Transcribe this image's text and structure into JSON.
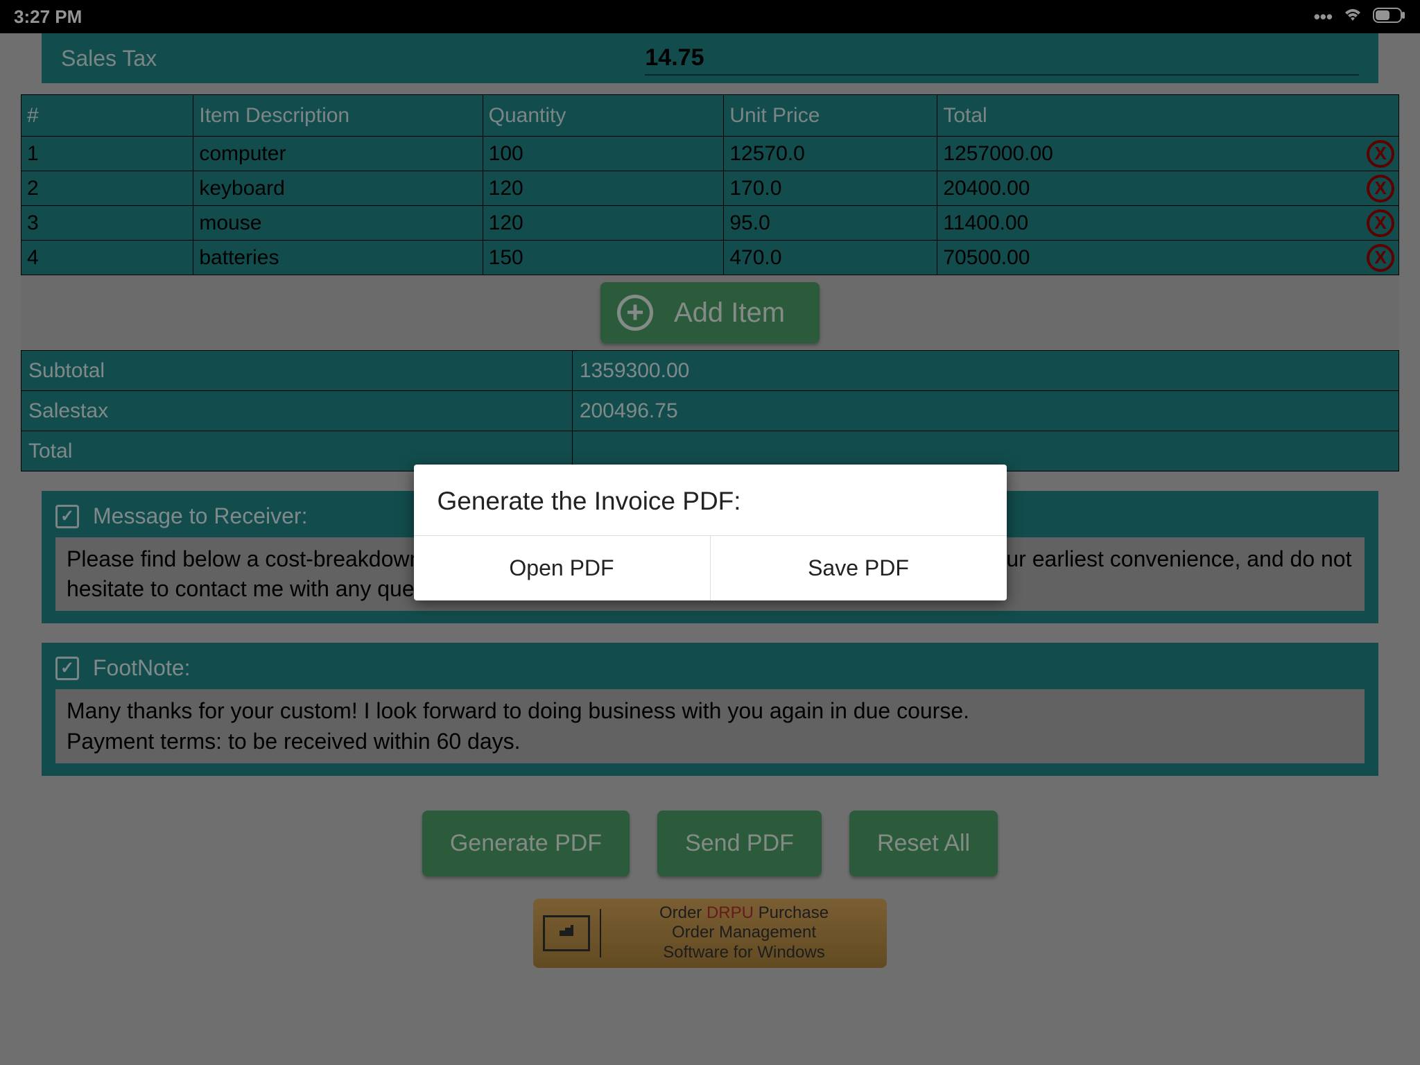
{
  "status": {
    "time": "3:27 PM"
  },
  "sales_tax": {
    "label": "Sales Tax",
    "value": "14.75"
  },
  "table": {
    "headers": {
      "num": "#",
      "desc": "Item Description",
      "qty": "Quantity",
      "price": "Unit Price",
      "total": "Total"
    },
    "rows": [
      {
        "num": "1",
        "desc": "computer",
        "qty": "100",
        "price": "12570.0",
        "total": "1257000.00"
      },
      {
        "num": "2",
        "desc": "keyboard",
        "qty": "120",
        "price": "170.0",
        "total": "20400.00"
      },
      {
        "num": "3",
        "desc": "mouse",
        "qty": "120",
        "price": "95.0",
        "total": "11400.00"
      },
      {
        "num": "4",
        "desc": "batteries",
        "qty": "150",
        "price": "470.0",
        "total": "70500.00"
      }
    ]
  },
  "add_item": "Add Item",
  "totals": {
    "subtotal_label": "Subtotal",
    "subtotal_value": "1359300.00",
    "salestax_label": "Salestax",
    "salestax_value": "200496.75",
    "total_label": "Total"
  },
  "message": {
    "label": "Message to Receiver:",
    "text": "Please find below a cost-breakdown for the recent work completed. Please make payment at your earliest convenience, and do not hesitate to contact me with any questions."
  },
  "footnote": {
    "label": "FootNote:",
    "text": "Many thanks for your custom! I look forward to doing business with you again in due course.\nPayment terms: to be received within 60 days."
  },
  "buttons": {
    "generate": "Generate PDF",
    "send": "Send PDF",
    "reset": "Reset All"
  },
  "ad": {
    "line1_pre": "Order ",
    "line1_drpu": "DRPU",
    "line1_post": " Purchase",
    "line2": "Order Management",
    "line3": "Software for Windows"
  },
  "dialog": {
    "title": "Generate the Invoice PDF:",
    "open": "Open PDF",
    "save": "Save PDF"
  }
}
